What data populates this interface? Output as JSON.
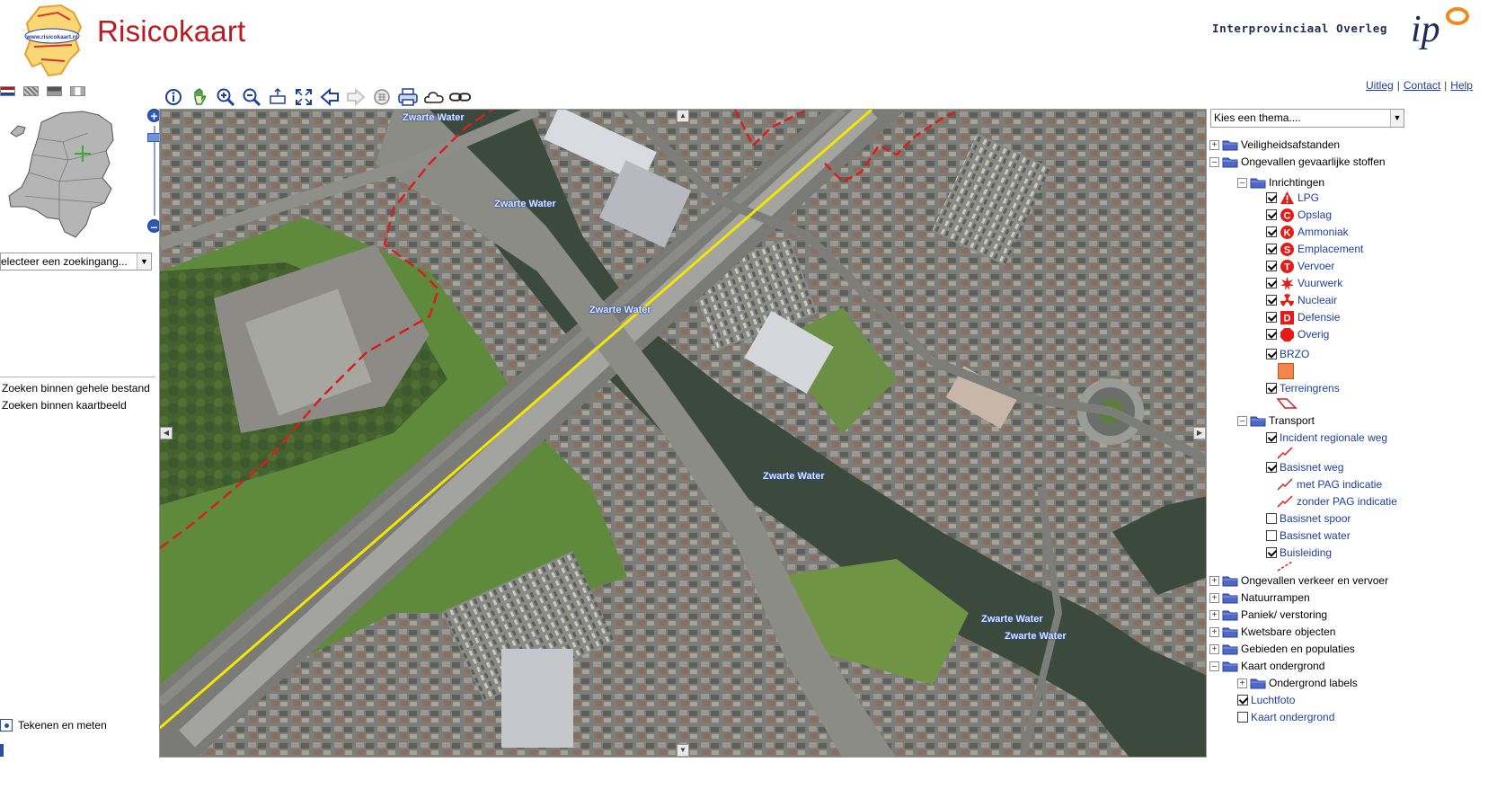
{
  "header": {
    "app_title": "Risicokaart",
    "logo_text": "www.risicokaart.nl",
    "org_name": "Interprovinciaal Overleg",
    "org_logo_text": "ip"
  },
  "top_links": [
    "Uitleg",
    "Contact",
    "Help"
  ],
  "left_panel": {
    "language_flags": [
      "nl-flag",
      "en-flag",
      "gray-theme",
      "print-theme"
    ],
    "search_select": "electeer  een zoekingang...",
    "search_options": [
      "Zoeken binnen gehele bestand",
      "Zoeken binnen kaartbeeld"
    ],
    "draw_tool_label": "Tekenen en meten"
  },
  "toolbar": {
    "tools": [
      "info-icon",
      "pan-hand-icon",
      "zoom-in-icon",
      "zoom-out-icon",
      "zoom-extent-icon",
      "full-extent-icon",
      "previous-extent-icon",
      "next-extent-icon",
      "table-icon",
      "print-icon",
      "cloud-icon",
      "link-icon"
    ]
  },
  "map": {
    "water_labels": [
      "Zwarte Water",
      "Zwarte Water",
      "Zwarte Water",
      "Zwarte Water",
      "Zwarte Water",
      "Zwarte Water"
    ],
    "colors": {
      "highway_line": "#ffee00",
      "boundary_line": "#d81e1e",
      "water": "#3d4a3d",
      "grass": "#5e8a3a"
    }
  },
  "right_panel": {
    "theme_select": "Kies een thema....",
    "tree": {
      "veiligheidsafstanden": "Veiligheidsafstanden",
      "ongevallen_stoffen": "Ongevallen gevaarlijke stoffen",
      "inrichtingen": "Inrichtingen",
      "inrichting_items": [
        {
          "label": "LPG",
          "checked": true,
          "symbol": "L",
          "color": "#e41b17"
        },
        {
          "label": "Opslag",
          "checked": true,
          "symbol": "C",
          "color": "#e41b17"
        },
        {
          "label": "Ammoniak",
          "checked": true,
          "symbol": "K",
          "color": "#e41b17"
        },
        {
          "label": "Emplacement",
          "checked": true,
          "symbol": "S",
          "color": "#e41b17"
        },
        {
          "label": "Vervoer",
          "checked": true,
          "symbol": "T",
          "color": "#e41b17"
        },
        {
          "label": "Vuurwerk",
          "checked": true,
          "symbol": "star",
          "color": "#e41b17"
        },
        {
          "label": "Nucleair",
          "checked": true,
          "symbol": "trefoil",
          "color": "#e41b17"
        },
        {
          "label": "Defensie",
          "checked": true,
          "symbol": "D",
          "color": "#e41b17"
        },
        {
          "label": "Overig",
          "checked": true,
          "symbol": "octagon",
          "color": "#e41b17"
        }
      ],
      "brzo": {
        "label": "BRZO",
        "checked": true,
        "swatch_color": "#f4844a"
      },
      "terreingrens": {
        "label": "Terreingrens",
        "checked": true
      },
      "transport": "Transport",
      "transport_items": {
        "incident_regionale_weg": {
          "label": "Incident regionale weg",
          "checked": true
        },
        "basisnet_weg": {
          "label": "Basisnet weg",
          "checked": true
        },
        "met_pag": "met PAG indicatie",
        "zonder_pag": "zonder PAG indicatie",
        "basisnet_spoor": {
          "label": "Basisnet spoor",
          "checked": false
        },
        "basisnet_water": {
          "label": "Basisnet water",
          "checked": false
        },
        "buisleiding": {
          "label": "Buisleiding",
          "checked": true
        }
      },
      "ongevallen_verkeer": "Ongevallen verkeer en vervoer",
      "natuurrampen": "Natuurrampen",
      "paniek": "Paniek/ verstoring",
      "kwetsbare": "Kwetsbare objecten",
      "gebieden": "Gebieden en populaties",
      "kaart_ondergrond": "Kaart ondergrond",
      "ondergrond_labels": "Ondergrond labels",
      "luchtfoto": {
        "label": "Luchtfoto",
        "checked": true
      },
      "kaart_ondergrond_item": {
        "label": "Kaart ondergrond",
        "checked": false
      }
    }
  }
}
